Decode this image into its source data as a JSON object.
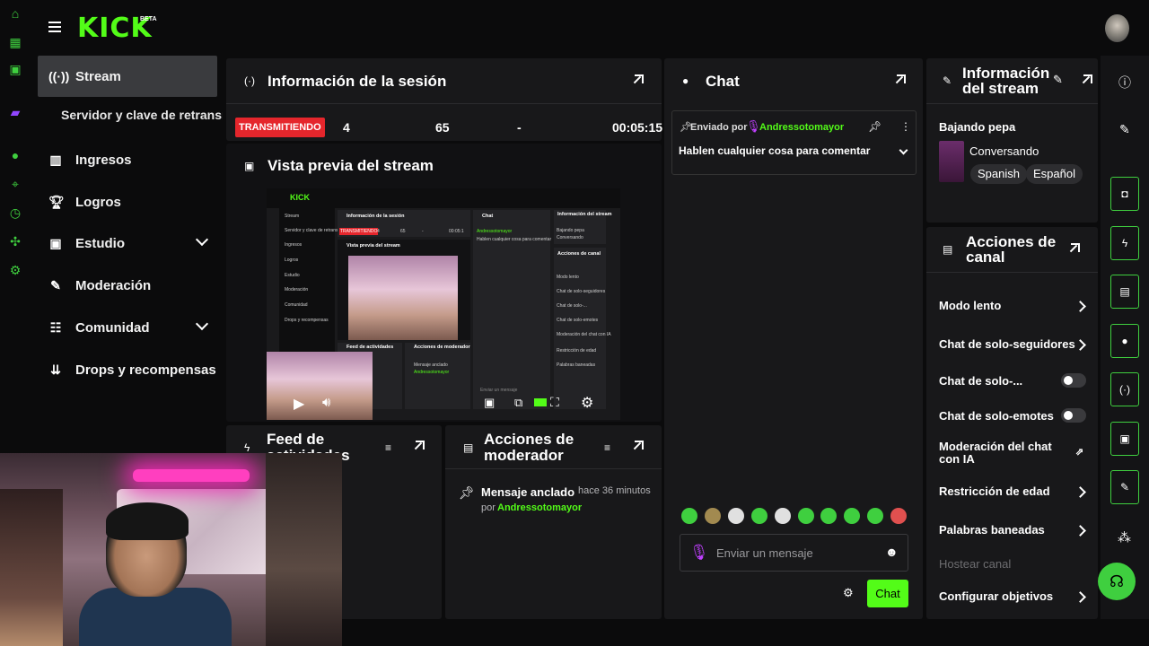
{
  "brand": {
    "logo": "KICK",
    "badge": "BETA",
    "accent": "#53fc18",
    "live_color": "#e5262c"
  },
  "rail_icons": [
    "dashboard-icon",
    "stripe-icon",
    "moderation-m-icon",
    "twitch-icon",
    "spotify-icon",
    "trophy-icon",
    "clock-icon",
    "puzzle-icon",
    "settings-icon"
  ],
  "sidebar": {
    "items": [
      {
        "label": "Stream",
        "icon": "broadcast-icon",
        "active": true
      },
      {
        "label": "Servidor y clave de retransmisión",
        "sub": true
      },
      {
        "label": "Ingresos",
        "icon": "chart-icon"
      },
      {
        "label": "Logros",
        "icon": "trophy-icon"
      },
      {
        "label": "Estudio",
        "icon": "studio-icon",
        "expandable": true
      },
      {
        "label": "Moderación",
        "icon": "wrench-icon"
      },
      {
        "label": "Comunidad",
        "icon": "community-icon",
        "expandable": true
      },
      {
        "label": "Drops y recompensas",
        "icon": "drops-icon"
      }
    ]
  },
  "session": {
    "title": "Información de la sesión",
    "status": "TRANSMITIENDO",
    "viewers": "4",
    "followers": "65",
    "subs": "-",
    "duration": "00:05:15"
  },
  "preview": {
    "title": "Vista previa del stream",
    "mini": {
      "logo": "KICK",
      "nav": [
        "Stream",
        "Servidor y clave de retrans",
        "Ingresos",
        "Logros",
        "Estudio",
        "Moderación",
        "Comunidad",
        "Drops y recompensas"
      ],
      "session_title": "Información de la sesión",
      "live": "TRANSMITIENDO",
      "stats": [
        "4",
        "65",
        "-",
        "00:05:1"
      ],
      "preview_title": "Vista previa del stream",
      "chat_title": "Chat",
      "chat_pinned_user": "Andressotomayor",
      "chat_pinned_msg": "Hablen cualquier cosa para comentar",
      "info_title": "Información del stream",
      "info_name": "Bajando pepa",
      "info_cat": "Conversando",
      "info_tags": [
        "Spanish",
        "Español"
      ],
      "actions_title": "Acciones de canal",
      "actions": [
        "Modo lento",
        "Chat de solo-seguidores",
        "Chat de solo-...",
        "Chat de solo-emotes",
        "Moderación del chat con IA",
        "Restricción de edad",
        "Palabras baneadas"
      ],
      "feed_title": "Feed de actividades",
      "mod_title": "Acciones de moderador",
      "mod_text": "Mensaje anclado",
      "mod_user": "Andressotomayor",
      "input": "Enviar un mensaje"
    }
  },
  "feed": {
    "title": "Feed de actividades"
  },
  "mod_actions": {
    "title": "Acciones de moderador",
    "event": "Mensaje anclado",
    "time": "hace 36 minutos",
    "by_prefix": "por",
    "by_user": "Andressotomayor"
  },
  "chat": {
    "title": "Chat",
    "pinned": {
      "sent_by": "Enviado por",
      "user": "Andressotomayor",
      "message": "Hablen cualquier cosa para comentar"
    },
    "input_placeholder": "Enviar un mensaje",
    "send_label": "Chat",
    "emotes": [
      "emote-1",
      "emote-2",
      "emote-3",
      "emote-4",
      "emote-5",
      "emote-6",
      "emote-7",
      "emote-8",
      "emote-9",
      "emote-10"
    ]
  },
  "stream_info": {
    "title": "Información del stream",
    "name": "Bajando pepa",
    "category": "Conversando",
    "tags": [
      "Spanish",
      "Español"
    ]
  },
  "channel_actions": {
    "title": "Acciones de canal",
    "rows": [
      {
        "label": "Modo lento",
        "control": "arrow"
      },
      {
        "label": "Chat de solo-seguidores",
        "control": "arrow"
      },
      {
        "label": "Chat de solo-...",
        "control": "toggle",
        "on": false
      },
      {
        "label": "Chat de solo-emotes",
        "control": "toggle",
        "on": false
      },
      {
        "label": "Moderación del chat con IA",
        "control": "external"
      },
      {
        "label": "Restricción de edad",
        "control": "arrow"
      },
      {
        "label": "Palabras baneadas",
        "control": "arrow"
      },
      {
        "label": "Hostear canal",
        "control": "none",
        "disabled": true
      },
      {
        "label": "Configurar objetivos",
        "control": "arrow"
      }
    ]
  },
  "tool_strip": [
    "info-icon",
    "edit-icon",
    "camera-icon",
    "lightning-icon",
    "document-icon",
    "chat-bubble-icon",
    "broadcast-icon",
    "video-icon",
    "wrench-icon",
    "dots-icon",
    "help-icon"
  ]
}
